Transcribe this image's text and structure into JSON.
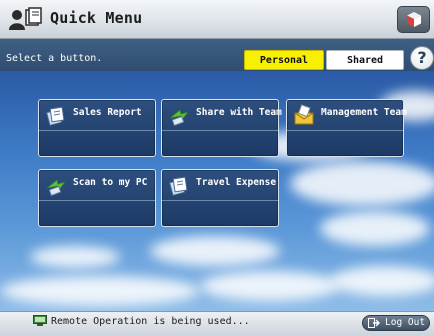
{
  "header": {
    "title": "Quick Menu",
    "title_icon": "user-document-icon",
    "right_icon": "paper-cube-icon"
  },
  "toolbar": {
    "message": "Select a button.",
    "tabs": [
      {
        "label": "Personal",
        "selected": true
      },
      {
        "label": "Shared",
        "selected": false
      }
    ],
    "help_label": "?"
  },
  "jobs": [
    {
      "label": "Sales Report",
      "icon": "document-stack-icon"
    },
    {
      "label": "Share with Team",
      "icon": "green-arrow-send-icon"
    },
    {
      "label": "Management Team",
      "icon": "envelope-mail-icon"
    },
    {
      "label": "Scan to my PC",
      "icon": "green-arrow-send-icon"
    },
    {
      "label": "Travel Expense",
      "icon": "document-stack-icon"
    }
  ],
  "status": {
    "message": "Remote Operation is being used...",
    "logout_label": "Log Out"
  },
  "colors": {
    "selected_tab": "#f7f000",
    "sky_top": "#2b5aa6",
    "button_bg": "#1d3a65"
  }
}
